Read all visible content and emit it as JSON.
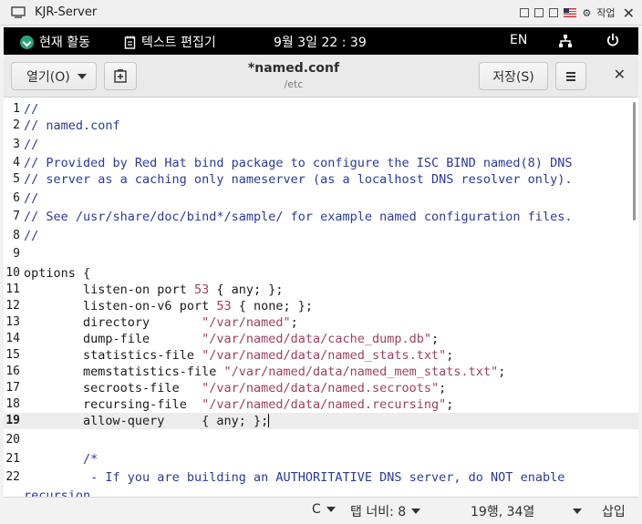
{
  "vm": {
    "title": "KJR-Server",
    "lang_label": "작업"
  },
  "topbar": {
    "activities": "현재 활동",
    "app": "텍스트 편집기",
    "clock": "9월 3일 22 : 39",
    "input": "EN"
  },
  "headerbar": {
    "open_label": "열기(O)",
    "title": "*named.conf",
    "subtitle": "/etc",
    "save_label": "저장(S)"
  },
  "editor": {
    "lines": [
      {
        "n": "1",
        "t": "//"
      },
      {
        "n": "2",
        "t": "// named.conf"
      },
      {
        "n": "3",
        "t": "//"
      },
      {
        "n": "4",
        "t": "// Provided by Red Hat bind package to configure the ISC BIND named(8) DNS"
      },
      {
        "n": "5",
        "t": "// server as a caching only nameserver (as a localhost DNS resolver only)."
      },
      {
        "n": "6",
        "t": "//"
      },
      {
        "n": "7",
        "t": "// See /usr/share/doc/bind*/sample/ for example named configuration files."
      },
      {
        "n": "8",
        "t": "//"
      },
      {
        "n": "9",
        "t": ""
      },
      {
        "n": "10",
        "t": "options {"
      },
      {
        "n": "11",
        "a": "\tlisten-on port ",
        "b": "53",
        "c": " { any; };"
      },
      {
        "n": "12",
        "a": "\tlisten-on-v6 port ",
        "b": "53",
        "c": " { none; };"
      },
      {
        "n": "13",
        "a": "\tdirectory \t",
        "s": "\"/var/named\"",
        "c": ";"
      },
      {
        "n": "14",
        "a": "\tdump-file \t",
        "s": "\"/var/named/data/cache_dump.db\"",
        "c": ";"
      },
      {
        "n": "15",
        "a": "\tstatistics-file ",
        "s": "\"/var/named/data/named_stats.txt\"",
        "c": ";"
      },
      {
        "n": "16",
        "a": "\tmemstatistics-file ",
        "s": "\"/var/named/data/named_mem_stats.txt\"",
        "c": ";"
      },
      {
        "n": "17",
        "a": "\tsecroots-file\t",
        "s": "\"/var/named/data/named.secroots\"",
        "c": ";"
      },
      {
        "n": "18",
        "a": "\trecursing-file\t",
        "s": "\"/var/named/data/named.recursing\"",
        "c": ";"
      },
      {
        "n": "19",
        "t": "\tallow-query     { any; };"
      },
      {
        "n": "20",
        "t": ""
      },
      {
        "n": "21",
        "t": "\t/*"
      },
      {
        "n": "22",
        "t": "\t - If you are building an AUTHORITATIVE DNS server, do NOT enable"
      },
      {
        "n": "",
        "t": "recursion."
      }
    ]
  },
  "statusbar": {
    "lang": "C",
    "tab_width": "탭 너비: 8",
    "position": "19행, 34열",
    "mode": "삽입"
  }
}
